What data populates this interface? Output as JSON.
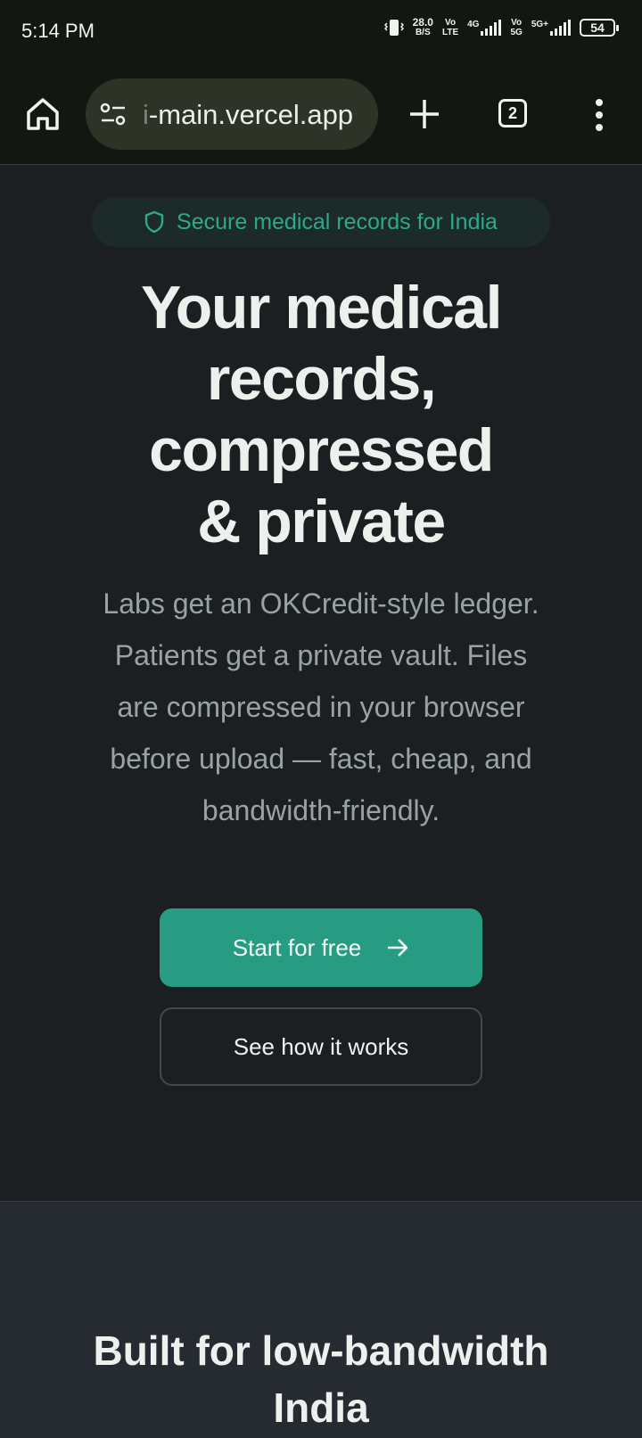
{
  "status_bar": {
    "time": "5:14 PM",
    "data_rate_value": "28.0",
    "data_rate_unit": "B/S",
    "sim1_top": "Vo",
    "sim1_bottom": "LTE",
    "sim1_network": "4G",
    "sim2_top": "Vo",
    "sim2_bottom": "5G",
    "sim2_network": "5G+",
    "battery": "54"
  },
  "browser": {
    "url_faded": "i",
    "url": "-main.vercel.app",
    "tab_count": "2"
  },
  "hero": {
    "badge": "Secure medical records for India",
    "headline_lines": [
      "Your medical",
      "records,",
      "compressed",
      "& private"
    ],
    "subtitle_lines": [
      "Labs get an OKCredit-style ledger.",
      "Patients get a private vault. Files",
      "are compressed in your browser",
      "before upload — fast, cheap, and",
      "bandwidth-friendly."
    ],
    "primary_cta": "Start for free",
    "secondary_cta": "See how it works"
  },
  "features": {
    "title_lines": [
      "Built for low-bandwidth",
      "India"
    ]
  },
  "colors": {
    "accent": "#279c83",
    "badge_text": "#2fa88a",
    "background": "#1b1f22",
    "section_background": "#252b31"
  }
}
